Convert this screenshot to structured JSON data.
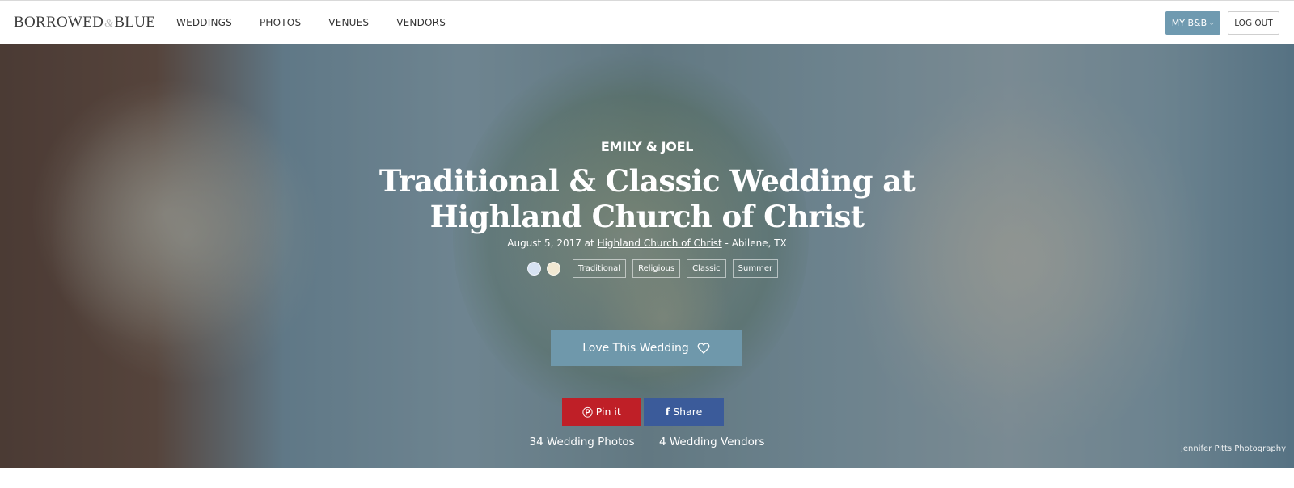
{
  "header": {
    "logo_left": "BORROWED",
    "logo_amp": "&",
    "logo_right": "BLUE",
    "nav": [
      {
        "label": "WEDDINGS"
      },
      {
        "label": "PHOTOS"
      },
      {
        "label": "VENUES"
      },
      {
        "label": "VENDORS"
      }
    ],
    "my_bb_label": "MY B&B",
    "logout_label": "LOG OUT"
  },
  "hero": {
    "couple": "EMILY & JOEL",
    "title": "Traditional & Classic Wedding at Highland Church of Christ",
    "date_prefix": "August 5, 2017 at",
    "venue": "Highland Church of Christ",
    "location_suffix": " - Abilene, TX",
    "swatches": [
      "#d6e2f2",
      "#f1e8d2"
    ],
    "tags": [
      "Traditional",
      "Religious",
      "Classic",
      "Summer"
    ],
    "love_label": "Love This Wedding",
    "pin_label": "Pin it",
    "share_label": "Share",
    "photos_count": "34 Wedding Photos",
    "vendors_count": "4 Wedding Vendors",
    "photo_credit": "Jennifer Pitts Photography"
  },
  "colors": {
    "accent": "#6f9ab0",
    "pinterest": "#bf1f27",
    "facebook": "#3b5b9a"
  }
}
